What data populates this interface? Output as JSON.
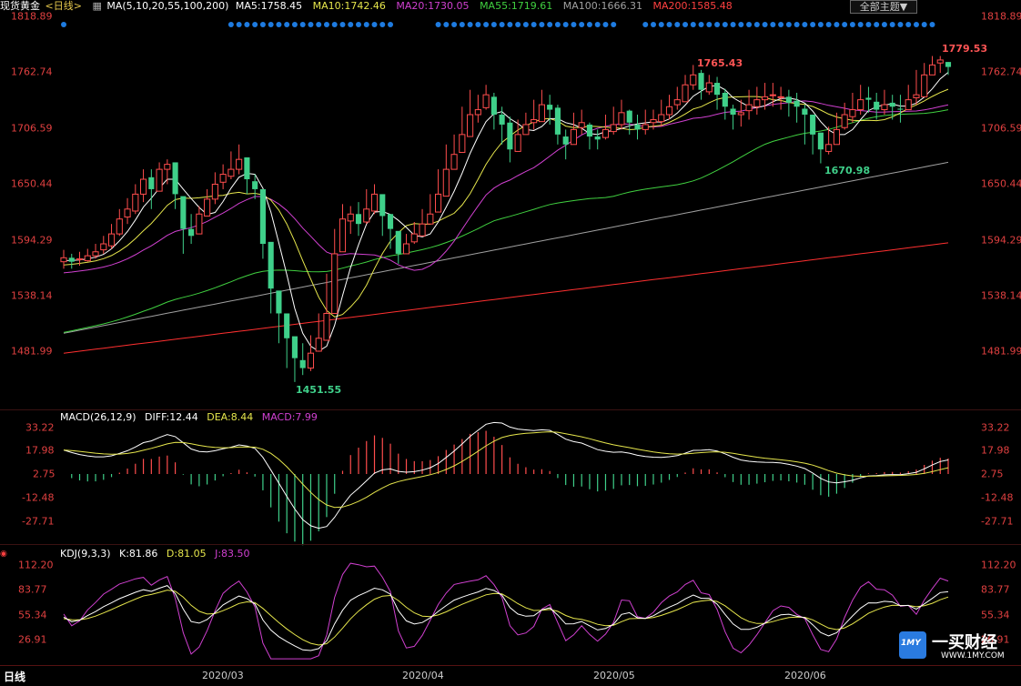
{
  "header": {
    "title": "现货黄金",
    "period": "<日线>",
    "ma_label": "MA(5,10,20,55,100,200)",
    "ma5": "MA5:1758.45",
    "ma10": "MA10:1742.46",
    "ma20": "MA20:1730.05",
    "ma55": "MA55:1719.61",
    "ma100": "MA100:1666.31",
    "ma200": "MA200:1585.48",
    "theme_button": "全部主题▼"
  },
  "colors": {
    "up": "#ff4d4d",
    "down": "#3fd08a",
    "ma5": "#ffffff",
    "ma10": "#e6e64c",
    "ma20": "#d040d0",
    "ma55": "#40d040",
    "ma100": "#a0a0a0",
    "ma200": "#ff3030",
    "dots": "#1e7be0"
  },
  "price_axis": [
    "1818.89",
    "1762.74",
    "1706.59",
    "1650.44",
    "1594.29",
    "1538.14",
    "1481.99"
  ],
  "annotations": {
    "high1": "1765.43",
    "high2": "1779.53",
    "low1": "1451.55",
    "low2": "1670.98"
  },
  "macd": {
    "label": "MACD(26,12,9)",
    "diff": "DIFF:12.44",
    "dea": "DEA:8.44",
    "macd": "MACD:7.99",
    "axis": [
      "33.22",
      "17.98",
      "2.75",
      "-12.48",
      "-27.71"
    ]
  },
  "kdj": {
    "label": "KDJ(9,3,3)",
    "k": "K:81.86",
    "d": "D:81.05",
    "j": "J:83.50",
    "axis": [
      "112.20",
      "83.77",
      "55.34",
      "26.91"
    ]
  },
  "bottom": {
    "tab": "日线",
    "months": [
      "2020/03",
      "2020/04",
      "2020/05",
      "2020/06"
    ]
  },
  "logo": {
    "badge": "1MY",
    "text": "一买财经",
    "url": "WWW.1MY.COM"
  },
  "chart_data": {
    "type": "candlestick",
    "instrument": "现货黄金",
    "closes": [
      1576,
      1572,
      1575,
      1578,
      1582,
      1590,
      1600,
      1615,
      1625,
      1640,
      1655,
      1645,
      1665,
      1670,
      1640,
      1605,
      1598,
      1620,
      1635,
      1650,
      1660,
      1665,
      1675,
      1655,
      1645,
      1590,
      1545,
      1520,
      1495,
      1475,
      1465,
      1480,
      1495,
      1520,
      1580,
      1615,
      1620,
      1610,
      1625,
      1640,
      1618,
      1605,
      1580,
      1590,
      1600,
      1610,
      1620,
      1640,
      1665,
      1680,
      1700,
      1720,
      1725,
      1740,
      1720,
      1710,
      1685,
      1700,
      1710,
      1715,
      1730,
      1725,
      1700,
      1690,
      1705,
      1712,
      1698,
      1695,
      1705,
      1710,
      1722,
      1712,
      1705,
      1710,
      1715,
      1720,
      1728,
      1735,
      1750,
      1760,
      1745,
      1752,
      1740,
      1728,
      1720,
      1722,
      1730,
      1735,
      1738,
      1740,
      1738,
      1732,
      1728,
      1720,
      1700,
      1685,
      1690,
      1705,
      1720,
      1725,
      1735,
      1735,
      1725,
      1730,
      1728,
      1725,
      1735,
      1740,
      1760,
      1770,
      1775,
      1768
    ],
    "highs": [
      1584,
      1580,
      1582,
      1585,
      1590,
      1598,
      1610,
      1625,
      1636,
      1650,
      1665,
      1665,
      1672,
      1675,
      1665,
      1625,
      1620,
      1628,
      1645,
      1662,
      1670,
      1683,
      1690,
      1675,
      1660,
      1610,
      1560,
      1540,
      1515,
      1493,
      1490,
      1498,
      1520,
      1560,
      1605,
      1630,
      1628,
      1632,
      1645,
      1650,
      1632,
      1618,
      1598,
      1600,
      1612,
      1625,
      1640,
      1665,
      1690,
      1700,
      1728,
      1745,
      1740,
      1750,
      1742,
      1728,
      1718,
      1715,
      1722,
      1735,
      1745,
      1740,
      1730,
      1705,
      1722,
      1725,
      1712,
      1705,
      1720,
      1728,
      1735,
      1725,
      1720,
      1725,
      1725,
      1735,
      1740,
      1748,
      1760,
      1770,
      1765,
      1760,
      1758,
      1746,
      1730,
      1735,
      1745,
      1748,
      1752,
      1752,
      1748,
      1745,
      1742,
      1730,
      1720,
      1695,
      1708,
      1722,
      1732,
      1742,
      1750,
      1748,
      1742,
      1745,
      1740,
      1740,
      1750,
      1765,
      1772,
      1779,
      1779,
      1773
    ],
    "lows": [
      1565,
      1565,
      1568,
      1572,
      1575,
      1580,
      1585,
      1598,
      1610,
      1620,
      1632,
      1625,
      1645,
      1650,
      1625,
      1580,
      1590,
      1600,
      1620,
      1630,
      1645,
      1655,
      1660,
      1640,
      1635,
      1575,
      1520,
      1490,
      1465,
      1451,
      1458,
      1462,
      1490,
      1505,
      1560,
      1590,
      1600,
      1598,
      1610,
      1620,
      1598,
      1585,
      1570,
      1580,
      1590,
      1600,
      1610,
      1628,
      1650,
      1665,
      1690,
      1705,
      1712,
      1725,
      1705,
      1690,
      1672,
      1690,
      1700,
      1705,
      1715,
      1710,
      1690,
      1675,
      1690,
      1700,
      1685,
      1685,
      1695,
      1700,
      1705,
      1700,
      1695,
      1700,
      1705,
      1708,
      1715,
      1725,
      1735,
      1745,
      1735,
      1740,
      1725,
      1715,
      1705,
      1708,
      1715,
      1720,
      1725,
      1728,
      1725,
      1718,
      1712,
      1690,
      1680,
      1671,
      1680,
      1692,
      1705,
      1712,
      1720,
      1722,
      1715,
      1720,
      1715,
      1712,
      1725,
      1730,
      1748,
      1760,
      1762,
      1760
    ],
    "ma_final": {
      "MA5": 1758.45,
      "MA10": 1742.46,
      "MA20": 1730.05,
      "MA55": 1719.61,
      "MA100": 1666.31,
      "MA200": 1585.48
    },
    "ylim": [
      1458,
      1820
    ]
  }
}
